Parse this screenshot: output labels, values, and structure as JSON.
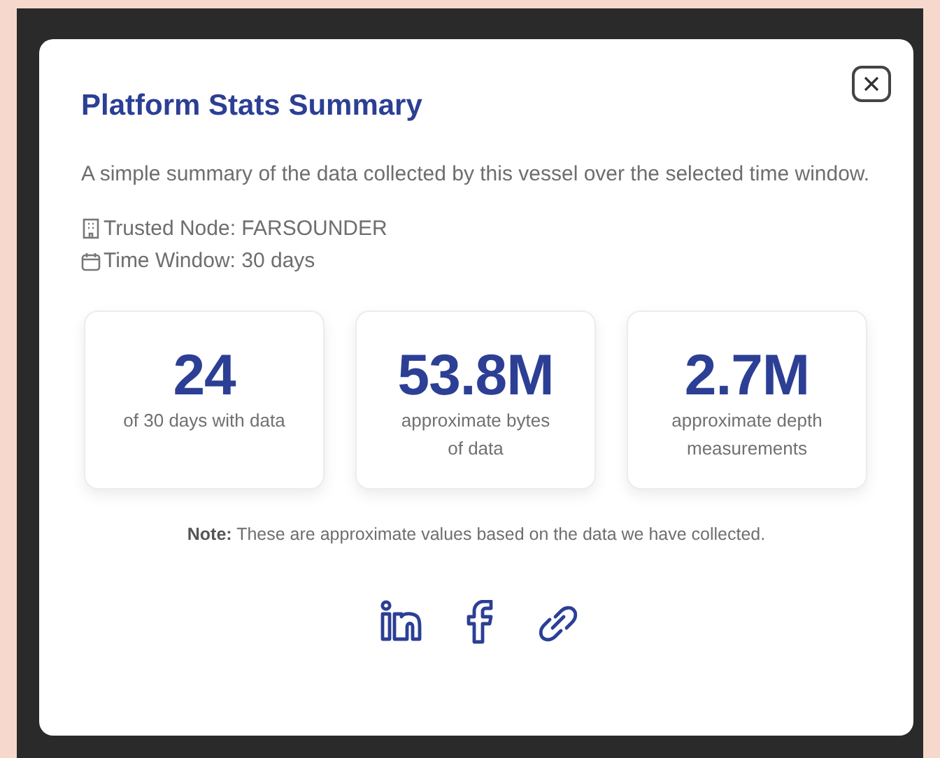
{
  "modal": {
    "title": "Platform Stats Summary",
    "description": "A simple summary of the data collected by this vessel over the selected time window.",
    "meta": [
      {
        "kind": "node",
        "text": "Trusted Node: FARSOUNDER"
      },
      {
        "kind": "window",
        "text": "Time Window: 30 days"
      }
    ],
    "stats": [
      {
        "value": "24",
        "label": "of 30 days with data"
      },
      {
        "value": "53.8M",
        "label": "approximate bytes of data"
      },
      {
        "value": "2.7M",
        "label": "approximate depth measurements"
      }
    ],
    "note": "**Note:** These are approximate values based on the data we have collected."
  }
}
